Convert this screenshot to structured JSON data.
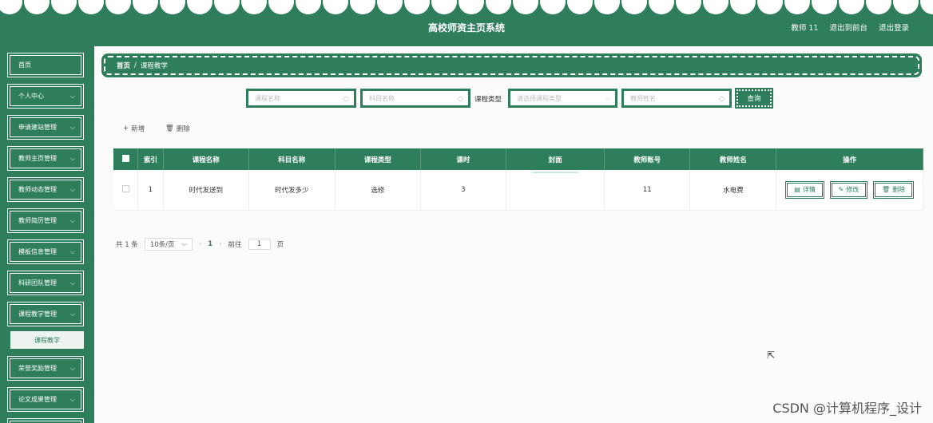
{
  "header": {
    "title": "高校师资主页系统",
    "user": "教师 11",
    "back_to_front": "退出到前台",
    "logout": "退出登录"
  },
  "sidebar": {
    "items": [
      {
        "label": "首页",
        "has_arrow": false
      },
      {
        "label": "个人中心",
        "has_arrow": true
      },
      {
        "label": "申请建站管理",
        "has_arrow": true
      },
      {
        "label": "教师主页管理",
        "has_arrow": true
      },
      {
        "label": "教师动态管理",
        "has_arrow": true
      },
      {
        "label": "教师简历管理",
        "has_arrow": true
      },
      {
        "label": "模板信息管理",
        "has_arrow": true
      },
      {
        "label": "科研团队管理",
        "has_arrow": true
      },
      {
        "label": "课程教学管理",
        "has_arrow": true
      },
      {
        "label": "荣誉奖励管理",
        "has_arrow": true
      },
      {
        "label": "论文成果管理",
        "has_arrow": true
      }
    ],
    "active_sub": "课程教学"
  },
  "breadcrumb": {
    "home": "首页",
    "separator": "/",
    "current": "课程教学"
  },
  "search": {
    "course_name_placeholder": "课程名称",
    "subject_name_placeholder": "科目名称",
    "course_type_label": "课程类型",
    "course_type_placeholder": "请选择课程类型",
    "teacher_name_placeholder": "教师姓名",
    "query_button": "查询"
  },
  "actions": {
    "add": "新增",
    "delete": "删除"
  },
  "table": {
    "headers": [
      "",
      "索引",
      "课程名称",
      "科目名称",
      "课程类型",
      "课时",
      "封面",
      "教师账号",
      "教师姓名",
      "操作"
    ],
    "rows": [
      {
        "index": "1",
        "course_name": "时代发送到",
        "subject_name": "时代发多少",
        "course_type": "选修",
        "hours": "3",
        "cover": "",
        "teacher_account": "11",
        "teacher_name": "水电费"
      }
    ],
    "row_actions": {
      "detail": "详情",
      "edit": "修改",
      "delete": "删除"
    }
  },
  "pagination": {
    "total": "共 1 条",
    "page_size": "10条/页",
    "current_page": "1",
    "goto_label": "前往",
    "goto_value": "1",
    "page_unit": "页"
  },
  "watermark": "CSDN @计算机程序_设计",
  "colors": {
    "primary": "#2e7d5b",
    "background": "#fbfbfb"
  }
}
